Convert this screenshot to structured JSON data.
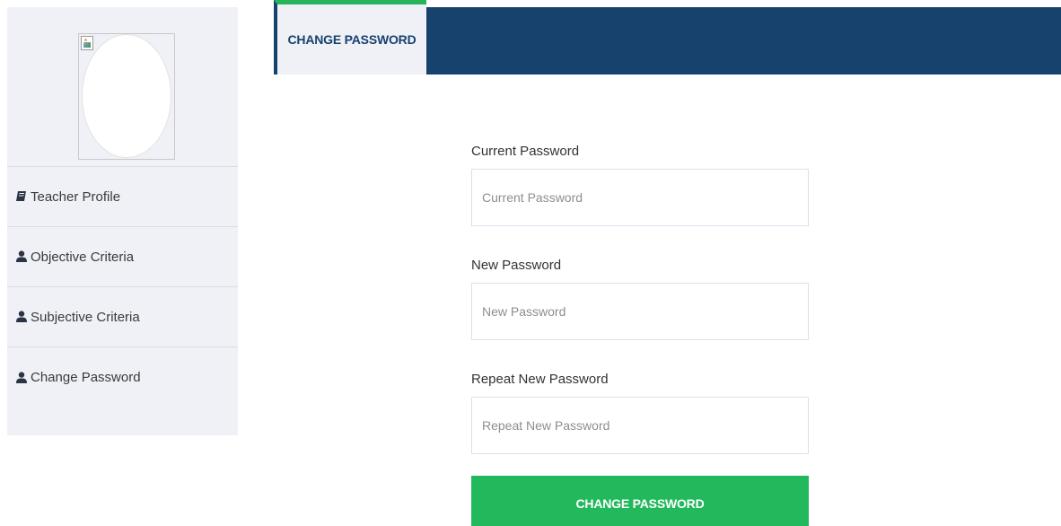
{
  "sidebar": {
    "items": [
      {
        "label": "Teacher Profile",
        "icon": "book-icon"
      },
      {
        "label": "Objective Criteria",
        "icon": "user-icon"
      },
      {
        "label": "Subjective Criteria",
        "icon": "user-icon"
      },
      {
        "label": "Change Password",
        "icon": "user-icon"
      }
    ]
  },
  "header": {
    "tab_label": "CHANGE PASSWORD"
  },
  "form": {
    "current": {
      "label": "Current Password",
      "placeholder": "Current Password"
    },
    "new": {
      "label": "New Password",
      "placeholder": "New Password"
    },
    "repeat": {
      "label": "Repeat New Password",
      "placeholder": "Repeat New Password"
    },
    "submit_label": "CHANGE PASSWORD"
  },
  "colors": {
    "header_bg": "#17426e",
    "accent_green": "#22b85c",
    "sidebar_bg": "#f0f1f7"
  }
}
